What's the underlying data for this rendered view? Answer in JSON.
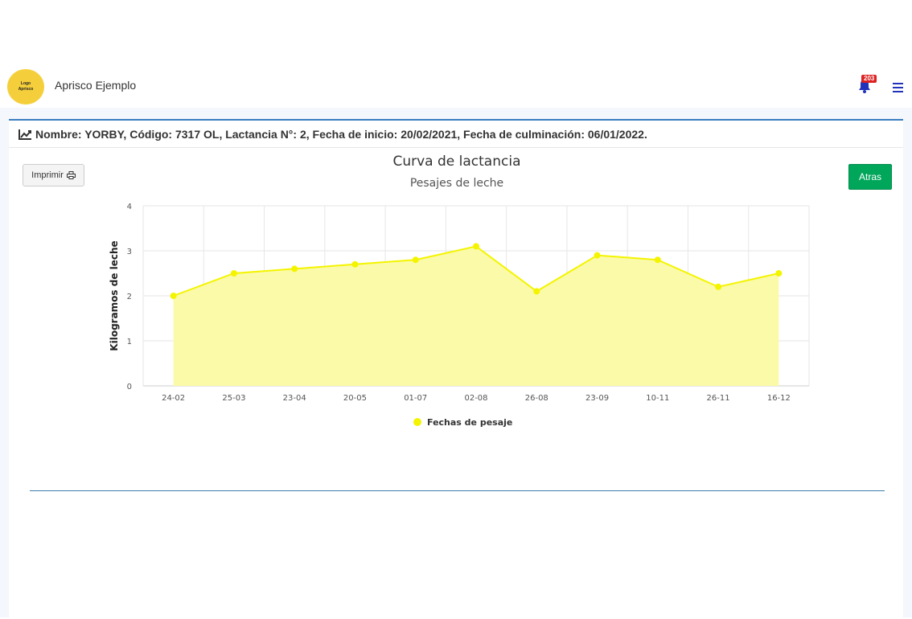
{
  "navbar": {
    "logo_line1": "Logo",
    "logo_line2": "Aprisco",
    "app_title": "Aprisco Ejemplo",
    "notification_count": "203",
    "accent_color": "#2233bb"
  },
  "card": {
    "header_text": "Nombre: YORBY, Código: 7317 OL, Lactancia N°: 2, Fecha de inicio: 20/02/2021, Fecha de culminación: 06/01/2022.",
    "print_label": "Imprimir",
    "back_label": "Atras"
  },
  "chart_data": {
    "type": "area",
    "title": "Curva de lactancia",
    "subtitle": "Pesajes de leche",
    "ylabel": "Kilogramos de leche",
    "xlabel": "",
    "categories": [
      "24-02",
      "25-03",
      "23-04",
      "20-05",
      "01-07",
      "02-08",
      "26-08",
      "23-09",
      "10-11",
      "26-11",
      "16-12"
    ],
    "series": [
      {
        "name": "Fechas de pesaje",
        "values": [
          2,
          2.5,
          2.6,
          2.7,
          2.8,
          3.1,
          2.1,
          2.9,
          2.8,
          2.2,
          2.5
        ],
        "color": "#f4f400",
        "fill": "#fafaa8"
      }
    ],
    "ylim": [
      0,
      4
    ],
    "yticks": [
      0,
      1,
      2,
      3,
      4
    ],
    "grid": true,
    "legend": "bottom-center"
  }
}
